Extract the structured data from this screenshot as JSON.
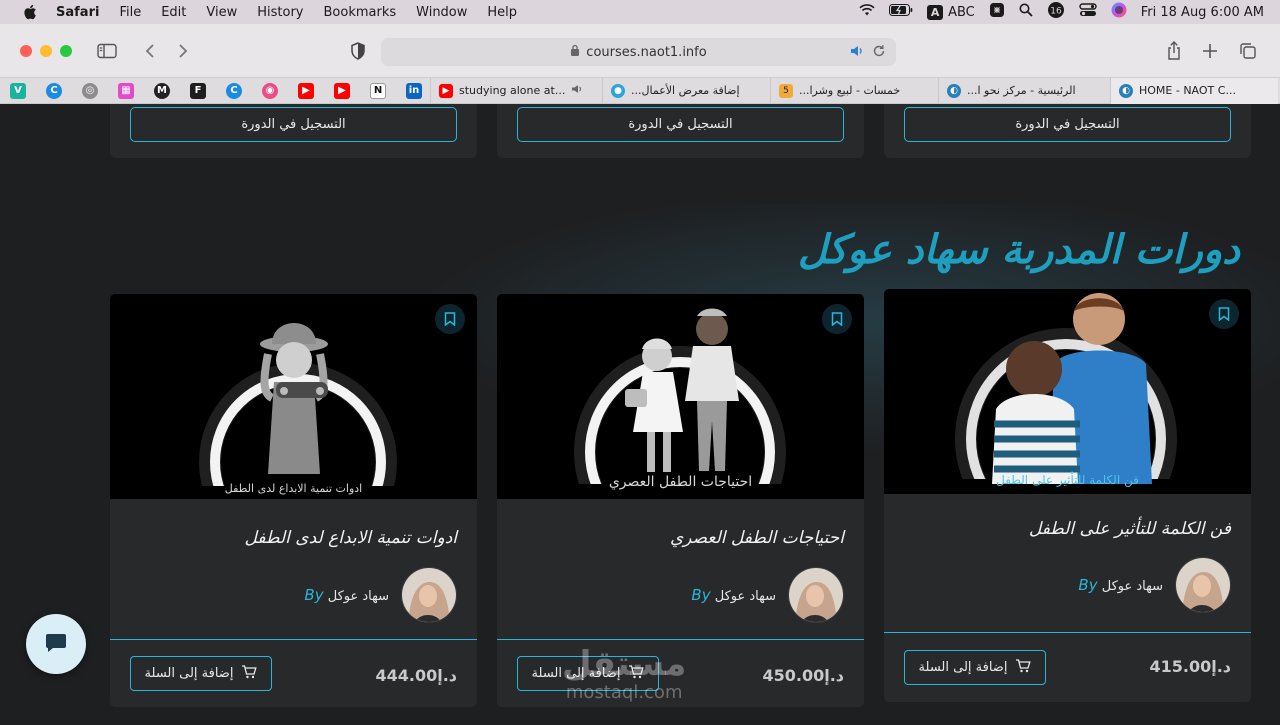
{
  "menubar": {
    "items": [
      "Safari",
      "File",
      "Edit",
      "View",
      "History",
      "Bookmarks",
      "Window",
      "Help"
    ],
    "input_source": "ABC",
    "datetime": "Fri 18 Aug  6:00 AM"
  },
  "browser": {
    "url": "courses.naot1.info",
    "tabs": [
      {
        "label": "studying alone at...",
        "icon": "youtube-icon",
        "color": "#ff0000"
      },
      {
        "label": "إضافة معرض الأعمال...",
        "icon": "mostaql-icon",
        "color": "#2ca4dc"
      },
      {
        "label": "خمسات - لبيع وشرا...",
        "icon": "khamsat-icon",
        "color": "#f2a93b"
      },
      {
        "label": "الرئيسية - مركز نحو ا...",
        "icon": "naot-icon",
        "color": "#2b7fb8"
      },
      {
        "label": "HOME - NAOT C...",
        "icon": "naot-icon",
        "color": "#2b7fb8"
      }
    ]
  },
  "page": {
    "top_cards": [
      {
        "button": "التسجيل في الدورة"
      },
      {
        "button": "التسجيل في الدورة"
      },
      {
        "button": "التسجيل في الدورة"
      }
    ],
    "section_title": "دورات المدربة سهاد عوكل",
    "courses": [
      {
        "image_caption": "فن الكلمة للتأثير على الطفل",
        "title": "فن الكلمة للتأثير على الطفل",
        "by": "By",
        "author": "سهاد عوكل",
        "price": "415.00",
        "currency": "د.إ",
        "cart_label": "إضافة إلى السلة"
      },
      {
        "image_caption": "احتياجات الطفل العصري",
        "title": "احتياجات الطفل العصري",
        "by": "By",
        "author": "سهاد عوكل",
        "price": "450.00",
        "currency": "د.إ",
        "cart_label": "إضافة إلى السلة"
      },
      {
        "image_caption": "ادوات تنمية الابداع لدى الطفل",
        "title": "ادوات تنمية الابداع لدى الطفل",
        "by": "By",
        "author": "سهاد عوكل",
        "price": "444.00",
        "currency": "د.إ",
        "cart_label": "إضافة إلى السلة"
      }
    ]
  },
  "watermark": {
    "arabic": "مستقل",
    "latin": "mostaql.com"
  },
  "colors": {
    "accent": "#29b6d9",
    "title": "#1f9fc0",
    "card": "#28292b",
    "background": "#1e1f21"
  }
}
